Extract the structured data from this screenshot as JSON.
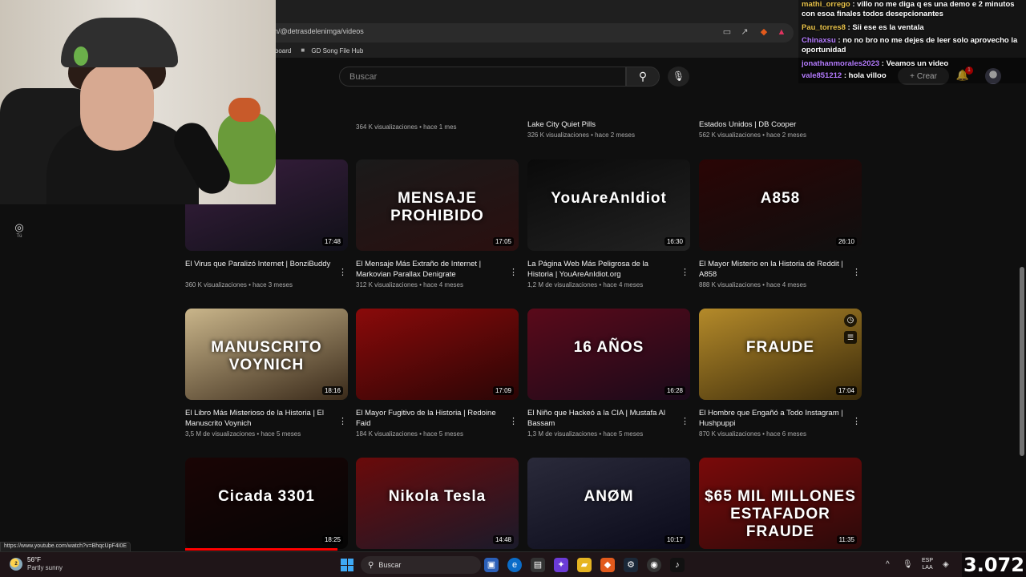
{
  "browser": {
    "url": "n/@detrasdelenimga/videos",
    "bookmarks": [
      "ashboard",
      "GD Song File Hub"
    ]
  },
  "header": {
    "search_placeholder": "Buscar",
    "create_label": "Crear",
    "notification_count": "1"
  },
  "sidebar": {
    "you_label": "Tú"
  },
  "top_partial_videos": [
    {
      "title": "",
      "meta": "364 K visualizaciones • hace 1 mes"
    },
    {
      "title": "Lake City Quiet Pills",
      "meta": "326 K visualizaciones • hace 2 meses"
    },
    {
      "title": "Estados Unidos | DB Cooper",
      "meta": "562 K visualizaciones • hace 2 meses"
    }
  ],
  "videos_row1": [
    {
      "thumb_text": "",
      "duration": "17:48",
      "title": "El Virus que Paralizó Internet | BonziBuddy",
      "meta": "360 K visualizaciones • hace 3 meses",
      "colors": [
        "#3a1f3f",
        "#101018"
      ]
    },
    {
      "thumb_text": "MENSAJE PROHIBIDO",
      "duration": "17:05",
      "title": "El Mensaje Más Extraño de Internet | Markovian Parallax Denigrate",
      "meta": "312 K visualizaciones • hace 4 meses",
      "colors": [
        "#1a1a1a",
        "#2a0f0f"
      ]
    },
    {
      "thumb_text": "YouAreAnIdiot",
      "duration": "16:30",
      "title": "La Página Web Más Peligrosa de la Historia | YouAreAnIdiot.org",
      "meta": "1,2 M de visualizaciones • hace 4 meses",
      "colors": [
        "#0a0a0a",
        "#222"
      ]
    },
    {
      "thumb_text": "A858",
      "duration": "26:10",
      "title": "El Mayor Misterio en la Historia de Reddit | A858",
      "meta": "888 K visualizaciones • hace 4 meses",
      "colors": [
        "#2a0505",
        "#0f0f0f"
      ]
    }
  ],
  "videos_row2": [
    {
      "thumb_text": "MANUSCRITO VOYNICH",
      "duration": "18:16",
      "title": "El Libro Más Misterioso de la Historia | El Manuscrito Voynich",
      "meta": "3,5 M de visualizaciones • hace 5 meses",
      "colors": [
        "#c9b58a",
        "#3a2a1a"
      ]
    },
    {
      "thumb_text": "",
      "duration": "17:09",
      "title": "El Mayor Fugitivo de la Historia | Redoine Faid",
      "meta": "184 K visualizaciones • hace 5 meses",
      "colors": [
        "#8a0a0a",
        "#2a0505"
      ]
    },
    {
      "thumb_text": "16 AÑOS",
      "duration": "16:28",
      "title": "El Niño que Hackeó a la CIA | Mustafa Al Bassam",
      "meta": "1,3 M de visualizaciones • hace 5 meses",
      "colors": [
        "#5a0a1a",
        "#1a0a1a"
      ]
    },
    {
      "thumb_text": "FRAUDE",
      "duration": "17:04",
      "title": "El Hombre que Engañó a Todo Instagram | Hushpuppi",
      "meta": "870 K visualizaciones • hace 6 meses",
      "colors": [
        "#b48a2a",
        "#3a2a0a"
      ]
    }
  ],
  "videos_row3": [
    {
      "thumb_text": "Cicada 3301",
      "duration": "18:25",
      "colors": [
        "#1a0505",
        "#050505"
      ]
    },
    {
      "thumb_text": "Nikola Tesla",
      "duration": "14:48",
      "colors": [
        "#6a0a0a",
        "#1a1a2a"
      ]
    },
    {
      "thumb_text": "ANØM",
      "duration": "10:17",
      "colors": [
        "#2a2a3a",
        "#0a0a1a"
      ]
    },
    {
      "thumb_text": "$65 MIL MILLONES  ESTAFADOR  FRAUDE",
      "duration": "11:35",
      "colors": [
        "#7a0a0a",
        "#2a0a0a"
      ]
    }
  ],
  "chat": [
    {
      "user": "mathi_orrego",
      "text": "villo no me diga q es una demo e 2 minutos con esoa finales todos desepcionantes",
      "color": "#e8c24a"
    },
    {
      "user": "Pau_torres8",
      "text": "Sii ese es la ventala",
      "color": "#e8c24a"
    },
    {
      "user": "Chinaxsu",
      "text": "no no bro no me dejes de leer solo aprovecho la oportunidad",
      "color": "#b57cff"
    },
    {
      "user": "jonathanmorales2023",
      "text": "Veamos un video",
      "color": "#b57cff"
    },
    {
      "user": "vale851212",
      "text": "hola villoo",
      "color": "#b57cff"
    }
  ],
  "status_url": "https://www.youtube.com/watch?v=BhqcUpF4I0E",
  "taskbar": {
    "temp": "56°F",
    "weather": "Partly sunny",
    "search": "Buscar",
    "lang1": "ESP",
    "lang2": "LAA",
    "counter": "3.072"
  }
}
